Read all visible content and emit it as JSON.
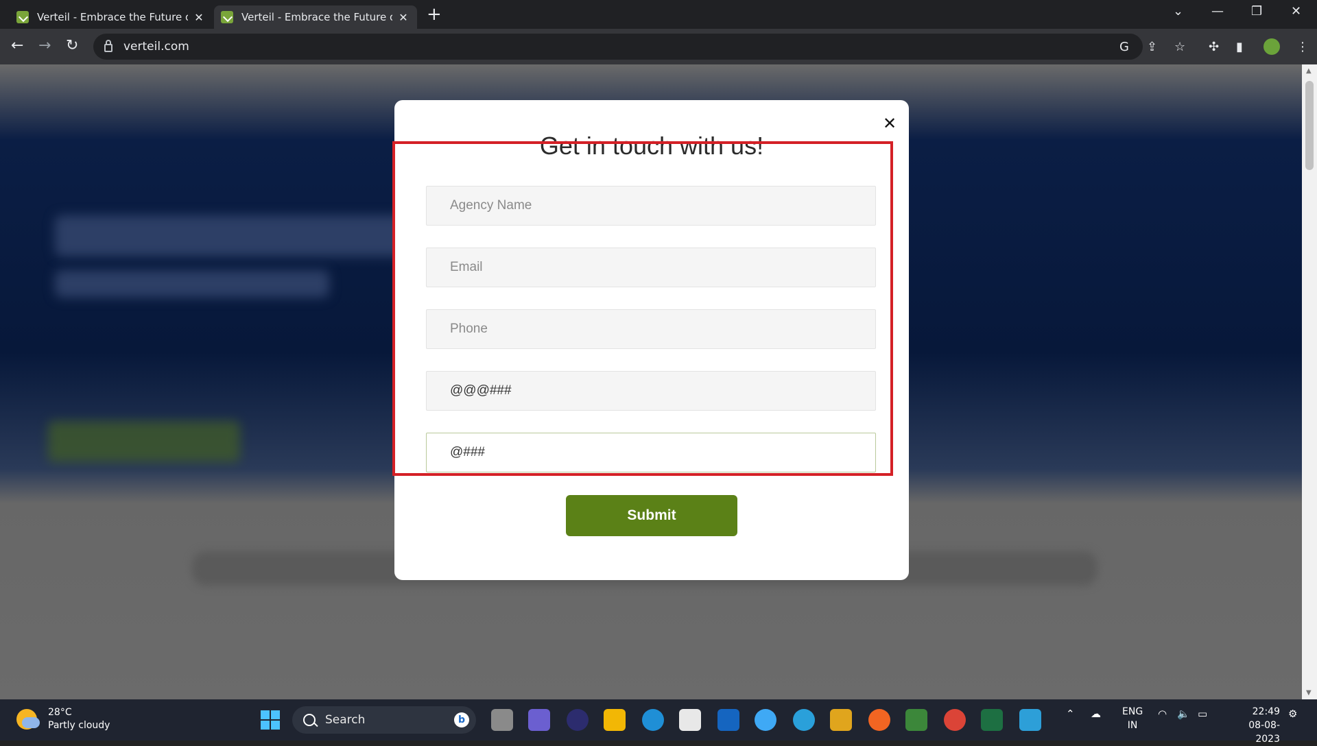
{
  "browser": {
    "tabs": [
      {
        "title": "Verteil - Embrace the Future of D",
        "active": false
      },
      {
        "title": "Verteil - Embrace the Future of D",
        "active": true
      }
    ],
    "url": "verteil.com"
  },
  "modal": {
    "title": "Get in touch with us!",
    "fields": [
      {
        "name": "agency-name",
        "placeholder": "Agency Name",
        "value": ""
      },
      {
        "name": "email",
        "placeholder": "Email",
        "value": ""
      },
      {
        "name": "phone",
        "placeholder": "Phone",
        "value": ""
      },
      {
        "name": "field-4",
        "placeholder": "",
        "value": "@@@###"
      },
      {
        "name": "field-5",
        "placeholder": "",
        "value": "@###"
      }
    ],
    "submit_label": "Submit",
    "close_icon": "close-icon"
  },
  "taskbar": {
    "weather_temp": "28°C",
    "weather_desc": "Partly cloudy",
    "search_label": "Search",
    "lang_top": "ENG",
    "lang_bottom": "IN",
    "time": "22:49",
    "date": "08-08-2023"
  },
  "colors": {
    "submit": "#5b8117",
    "highlight": "#d42026",
    "tab_bar": "#202124"
  }
}
